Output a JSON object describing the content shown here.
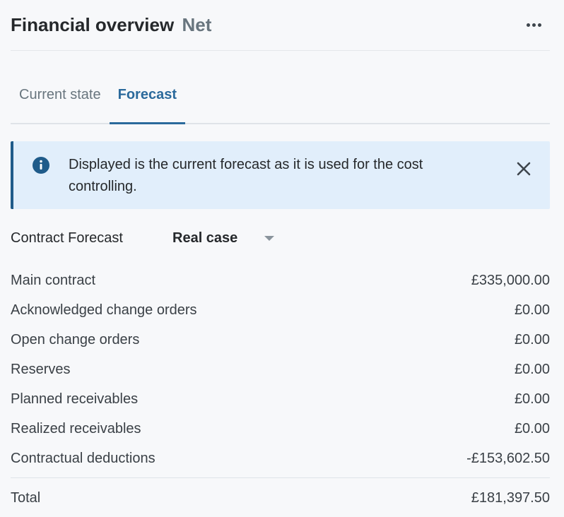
{
  "header": {
    "title": "Financial overview",
    "subtitle": "Net",
    "more_icon": "more-horizontal-icon"
  },
  "tabs": [
    {
      "label": "Current state",
      "active": false
    },
    {
      "label": "Forecast",
      "active": true
    }
  ],
  "banner": {
    "icon": "info-icon",
    "text": "Displayed is the current forecast as it is used for the cost controlling.",
    "close_icon": "close-icon"
  },
  "forecast": {
    "label": "Contract Forecast",
    "selected": "Real case"
  },
  "rows": [
    {
      "label": "Main contract",
      "amount": "£335,000.00"
    },
    {
      "label": "Acknowledged change orders",
      "amount": "£0.00"
    },
    {
      "label": "Open change orders",
      "amount": "£0.00"
    },
    {
      "label": "Reserves",
      "amount": "£0.00"
    },
    {
      "label": "Planned receivables",
      "amount": "£0.00"
    },
    {
      "label": "Realized receivables",
      "amount": "£0.00"
    },
    {
      "label": "Contractual deductions",
      "amount": "-£153,602.50"
    }
  ],
  "total": {
    "label": "Total",
    "amount": "£181,397.50"
  },
  "colors": {
    "accent": "#2b6a9c",
    "banner_bg": "#e1eefb",
    "banner_border": "#1f5b8a",
    "background": "#f7f8fa"
  }
}
